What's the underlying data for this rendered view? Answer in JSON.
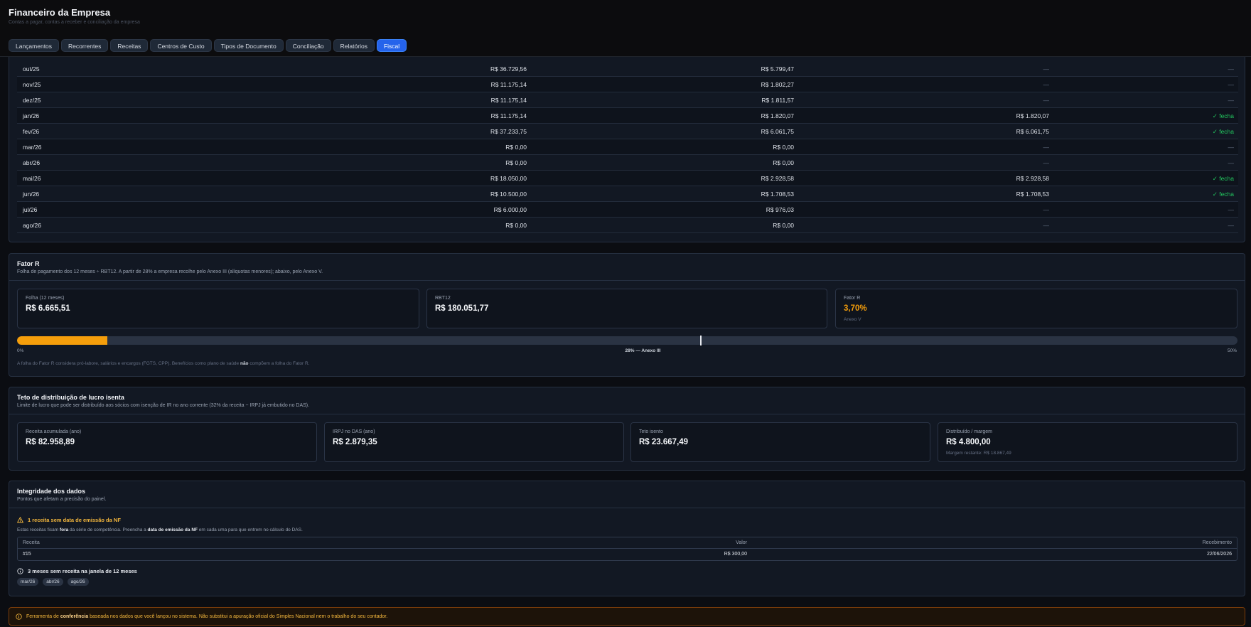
{
  "app": {
    "title": "Financeiro da Empresa",
    "subtitle": "Contas a pagar, contas a receber e conciliação da empresa"
  },
  "tabs": [
    {
      "label": "Lançamentos",
      "active": false
    },
    {
      "label": "Recorrentes",
      "active": false
    },
    {
      "label": "Receitas",
      "active": false
    },
    {
      "label": "Centros de Custo",
      "active": false
    },
    {
      "label": "Tipos de Documento",
      "active": false
    },
    {
      "label": "Conciliação",
      "active": false
    },
    {
      "label": "Relatórios",
      "active": false
    },
    {
      "label": "Fiscal",
      "active": true
    }
  ],
  "monthly_table": {
    "rows": [
      {
        "month": "out/25",
        "receita": "R$ 36.729,56",
        "das": "R$ 5.799,47",
        "pago": "—",
        "status": "—"
      },
      {
        "month": "nov/25",
        "receita": "R$ 11.175,14",
        "das": "R$ 1.802,27",
        "pago": "—",
        "status": "—"
      },
      {
        "month": "dez/25",
        "receita": "R$ 11.175,14",
        "das": "R$ 1.811,57",
        "pago": "—",
        "status": "—"
      },
      {
        "month": "jan/26",
        "receita": "R$ 11.175,14",
        "das": "R$ 1.820,07",
        "pago": "R$ 1.820,07",
        "status": "✓ fecha"
      },
      {
        "month": "fev/26",
        "receita": "R$ 37.233,75",
        "das": "R$ 6.061,75",
        "pago": "R$ 6.061,75",
        "status": "✓ fecha"
      },
      {
        "month": "mar/26",
        "receita": "R$ 0,00",
        "das": "R$ 0,00",
        "pago": "—",
        "status": "—"
      },
      {
        "month": "abr/26",
        "receita": "R$ 0,00",
        "das": "R$ 0,00",
        "pago": "—",
        "status": "—"
      },
      {
        "month": "mai/26",
        "receita": "R$ 18.050,00",
        "das": "R$ 2.928,58",
        "pago": "R$ 2.928,58",
        "status": "✓ fecha"
      },
      {
        "month": "jun/26",
        "receita": "R$ 10.500,00",
        "das": "R$ 1.708,53",
        "pago": "R$ 1.708,53",
        "status": "✓ fecha"
      },
      {
        "month": "jul/26",
        "receita": "R$ 6.000,00",
        "das": "R$ 976,03",
        "pago": "—",
        "status": "—"
      },
      {
        "month": "ago/26",
        "receita": "R$ 0,00",
        "das": "R$ 0,00",
        "pago": "—",
        "status": "—"
      }
    ]
  },
  "fator_r": {
    "title": "Fator R",
    "subtitle": "Folha de pagamento dos 12 meses ÷ RBT12. A partir de 28% a empresa recolhe pelo Anexo III (alíquotas menores); abaixo, pelo Anexo V.",
    "stats": [
      {
        "label": "Folha (12 meses)",
        "value": "R$ 6.665,51",
        "note": ""
      },
      {
        "label": "RBT12",
        "value": "R$ 180.051,77",
        "note": ""
      },
      {
        "label": "Fator R",
        "value": "3,70%",
        "note": "Anexo V"
      }
    ],
    "bar": {
      "value_percent": 3.7,
      "max_percent": 50,
      "threshold_percent": 28,
      "label_min": "0%",
      "label_threshold": "28% — Anexo III",
      "label_max": "50%"
    },
    "footnote_pre": "A folha do Fator R considera pró-labore, salários e encargos (FGTS, CPP). Benefícios como plano de saúde ",
    "footnote_bold": "não",
    "footnote_post": " compõem a folha do Fator R."
  },
  "teto": {
    "title": "Teto de distribuição de lucro isenta",
    "subtitle": "Limite de lucro que pode ser distribuído aos sócios com isenção de IR no ano corrente (32% da receita − IRPJ já embutido no DAS).",
    "stats": [
      {
        "label": "Receita acumulada (ano)",
        "value": "R$ 82.958,89",
        "note": ""
      },
      {
        "label": "IRPJ no DAS (ano)",
        "value": "R$ 2.879,35",
        "note": ""
      },
      {
        "label": "Teto isento",
        "value": "R$ 23.667,49",
        "note": ""
      },
      {
        "label": "Distribuído / margem",
        "value": "R$ 4.800,00",
        "note": "Margem restante: R$ 18.867,49"
      }
    ]
  },
  "integridade": {
    "title": "Integridade dos dados",
    "subtitle": "Pontos que afetam a precisão do painel.",
    "warning_title": "1 receita sem data de emissão da NF",
    "warning_text_1": "Estas receitas ficam ",
    "warning_bold_1": "fora",
    "warning_text_2": " da série de competência. Preencha a ",
    "warning_bold_2": "data de emissão da NF",
    "warning_text_3": " em cada uma para que entrem no cálculo do DAS.",
    "table_headers": {
      "receita": "Receita",
      "valor": "Valor",
      "recebimento": "Recebimento"
    },
    "table_rows": [
      {
        "receita": "#15",
        "valor": "R$ 300,00",
        "recebimento": "22/06/2026"
      }
    ],
    "info_title": "3 meses sem receita na janela de 12 meses",
    "missing_months": [
      "mar/26",
      "abr/26",
      "ago/26"
    ]
  },
  "disclaimer": {
    "text_pre": "Ferramenta de ",
    "text_bold": "conferência",
    "text_post": " baseada nos dados que você lançou no sistema. Não substitui a apuração oficial do Simples Nacional nem o trabalho do seu contador."
  },
  "colors": {
    "accent": "#2563eb",
    "warning": "#f59e0b",
    "success": "#22c55e",
    "background": "#0b0d12",
    "card": "#121823"
  }
}
